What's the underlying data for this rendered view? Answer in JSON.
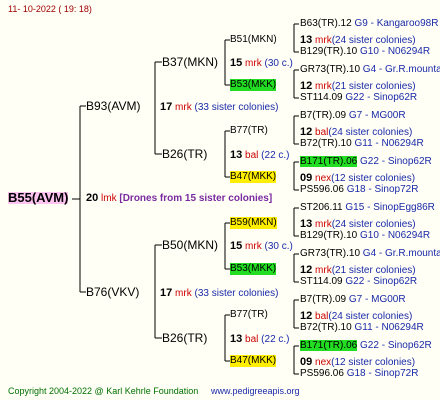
{
  "header": {
    "date": "11- 10-2022 ( 19: 18)"
  },
  "footer": {
    "copyright": "Copyright 2004-2022 @ Karl Kehrle Foundation",
    "site": "www.pedigreeapis.org"
  },
  "root": {
    "name": "B55(AVM)",
    "num": "20",
    "unit": "lmk",
    "note": "[Drones from 15 sister colonies]"
  },
  "gen1": [
    {
      "name": "B93(AVM)",
      "num": "17",
      "unit": "mrk",
      "note": "(33 sister colonies)"
    },
    {
      "name": "B76(VKV)",
      "num": "17",
      "unit": "mrk",
      "note": "(33 sister colonies)"
    }
  ],
  "gen2": [
    {
      "name": "B37(MKN)",
      "num": "15",
      "unit": "mrk",
      "note": "(30 c.)"
    },
    {
      "name": "B26(TR)",
      "num": "13",
      "unit": "bal",
      "note": "(22 c.)"
    },
    {
      "name": "B50(MKN)",
      "num": "15",
      "unit": "mrk",
      "note": "(30 c.)"
    },
    {
      "name": "B26(TR)",
      "num": "13",
      "unit": "bal",
      "note": "(22 c.)"
    }
  ],
  "gen3": [
    {
      "name": "B51(MKN)",
      "num": "13",
      "unit": "mrk",
      "note": "(24 sister colonies)"
    },
    {
      "name": "B53(MKK)",
      "num": "12",
      "unit": "mrk",
      "note": "(21 sister colonies)"
    },
    {
      "name": "B77(TR)",
      "num": "12",
      "unit": "bal",
      "note": "(24 sister colonies)"
    },
    {
      "name": "B47(MKK)",
      "num": "09",
      "unit": "nex",
      "note": "(12 sister colonies)"
    },
    {
      "name": "B59(MKN)",
      "num": "13",
      "unit": "mrk",
      "note": "(24 sister colonies)"
    },
    {
      "name": "B53(MKK)",
      "num": "12",
      "unit": "mrk",
      "note": "(21 sister colonies)"
    },
    {
      "name": "B77(TR)",
      "num": "12",
      "unit": "bal",
      "note": "(24 sister colonies)"
    },
    {
      "name": "B47(MKK)",
      "num": "09",
      "unit": "nex",
      "note": "(12 sister colonies)"
    }
  ],
  "gen4": [
    {
      "name": "B63(TR).12",
      "info": "G9 - Kangaroo98R"
    },
    {
      "name": "B129(TR).10",
      "info": "G10 - N06294R"
    },
    {
      "name": "GR73(TR).10",
      "info": "G4 - Gr.R.mounta"
    },
    {
      "name": "ST114.09",
      "info": "G22 - Sinop62R"
    },
    {
      "name": "B7(TR).09",
      "info": "G7 - MG00R"
    },
    {
      "name": "B72(TR).10",
      "info": "G11 - N06294R"
    },
    {
      "name": "B171(TR).06",
      "info": "G22 - Sinop62R"
    },
    {
      "name": "PS596.06",
      "info": "G18 - Sinop72R"
    },
    {
      "name": "ST206.11",
      "info": "G15 - SinopEgg86R"
    },
    {
      "name": "B129(TR).10",
      "info": "G10 - N06294R"
    },
    {
      "name": "GR73(TR).10",
      "info": "G4 - Gr.R.mounta"
    },
    {
      "name": "ST114.09",
      "info": "G22 - Sinop62R"
    },
    {
      "name": "B7(TR).09",
      "info": "G7 - MG00R"
    },
    {
      "name": "B72(TR).10",
      "info": "G11 - N06294R"
    },
    {
      "name": "B171(TR).06",
      "info": "G22 - Sinop62R"
    },
    {
      "name": "PS596.06",
      "info": "G18 - Sinop72R"
    }
  ],
  "colors": {
    "line": "#000000",
    "highlight_green": "#22dd22",
    "highlight_yellow": "#ffee00",
    "highlight_pink": "#ffc4f0",
    "info_blue": "#1a2aa8"
  }
}
